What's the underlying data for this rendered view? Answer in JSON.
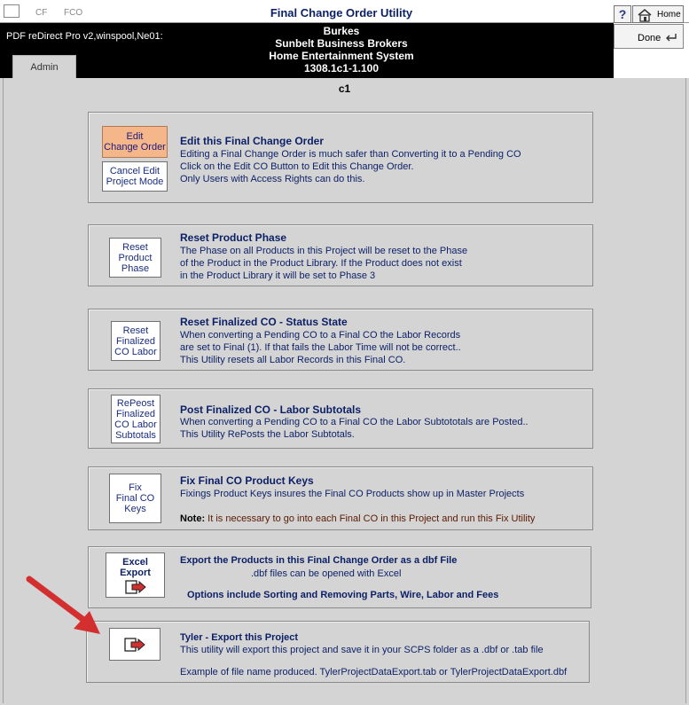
{
  "titlebar": {
    "tab_cf": "CF",
    "tab_fco": "FCO",
    "title": "Final Change Order Utility",
    "help_label": "?",
    "home_label": "Home"
  },
  "header": {
    "pdf_label": "PDF reDirect Pro v2,winspool,Ne01:",
    "line1": "Burkes",
    "line2": "Sunbelt Business Brokers",
    "line3": "Home Entertainment System",
    "line4": "1308.1c1-1.100",
    "admin_tab": "Admin",
    "done_label": "Done"
  },
  "section_id": "c1",
  "panels": {
    "edit": {
      "edit_btn_line1": "Edit",
      "edit_btn_line2": "Change Order",
      "cancel_btn_line1": "Cancel Edit",
      "cancel_btn_line2": "Project Mode",
      "title": "Edit this Final Change Order",
      "text1": "Editing a Final Change Order is much safer than Converting it to a Pending CO",
      "text2": "Click on the Edit CO Button to Edit this Change Order.",
      "text3": "Only Users with Access Rights can do this."
    },
    "reset_phase": {
      "btn_line1": "Reset",
      "btn_line2": "Product",
      "btn_line3": "Phase",
      "title": "Reset Product Phase",
      "text1": "The Phase on all Products in this Project will be reset to the Phase",
      "text2": "of the Product in the Product Library. If the Product does not exist",
      "text3": "in the Product Library it will be set to Phase 3"
    },
    "reset_status": {
      "btn_line1": "Reset",
      "btn_line2": "Finalized",
      "btn_line3": "CO Labor",
      "title": "Reset Finalized CO - Status State",
      "text1": "When converting a Pending CO to a Final CO the Labor Records",
      "text2": "are set to Final (1).   If that fails the Labor Time will not be correct..",
      "text3": "This Utility resets all Labor Records in this Final CO."
    },
    "post_subtotals": {
      "btn_line1": "RePeost",
      "btn_line2": "Finalized",
      "btn_line3": "CO Labor",
      "btn_line4": "Subtotals",
      "title": "Post Finalized CO - Labor Subtotals",
      "text1": "When converting a Pending CO to a Final CO the Labor Subtototals are Posted..",
      "text2": "This Utility RePosts the Labor Subtotals."
    },
    "fix_keys": {
      "btn_line1": "Fix",
      "btn_line2": "Final CO",
      "btn_line3": "Keys",
      "title": "Fix Final CO Product Keys",
      "text1": "Fixings Product Keys insures the Final CO Products show up in Master Projects",
      "note_label": "Note:",
      "note_text": " It is necessary to go into each Final CO in this Project and run this Fix Utility"
    },
    "excel": {
      "btn_line1": "Excel",
      "btn_line2": "Export",
      "title": "Export the Products in this Final Change Order as a dbf File",
      "text1": ".dbf files can be opened with Excel",
      "text2": "Options include Sorting and Removing Parts, Wire, Labor and Fees"
    },
    "tyler": {
      "title": "Tyler - Export this Project",
      "text1": "This utility will export this project and save it in your SCPS folder as a .dbf or .tab file",
      "text2": "Example of file name produced. TylerProjectDataExport.tab or TylerProjectDataExport.dbf"
    }
  },
  "colors": {
    "accent": "#0b1f66",
    "edit_button": "#f5b68a",
    "arrow": "#d32f2f",
    "background": "#d4d4d4"
  }
}
